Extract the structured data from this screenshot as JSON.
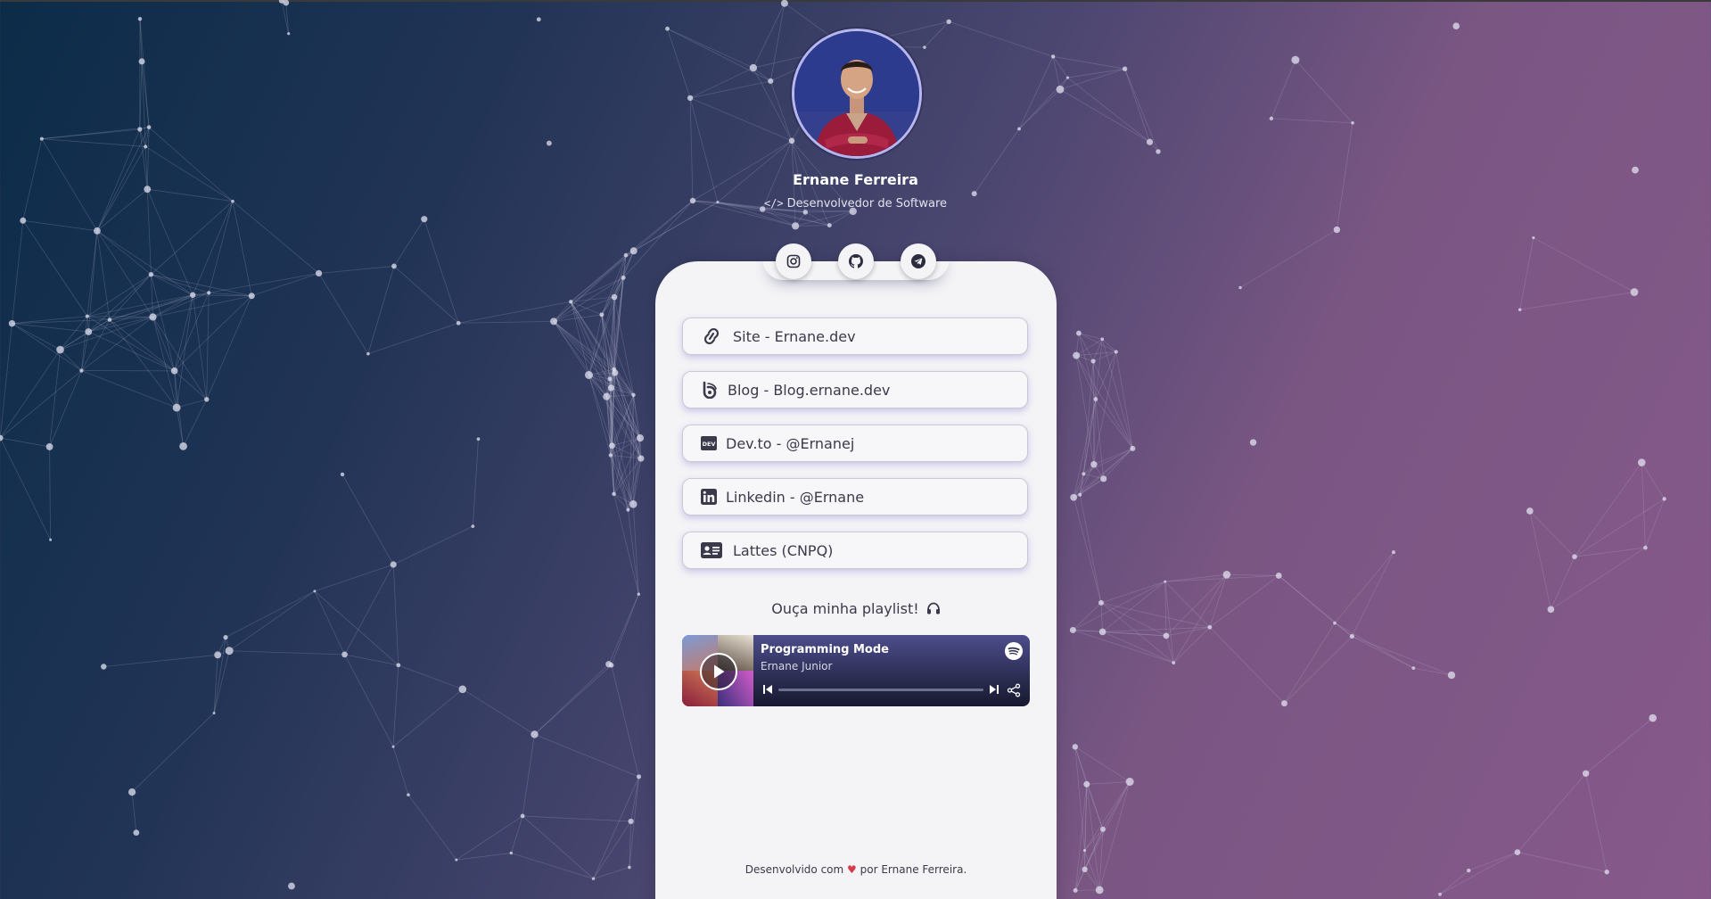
{
  "profile": {
    "name": "Ernane Ferreira",
    "role_icon": "</>",
    "role": "Desenvolvedor de Software",
    "avatar_icon": "avatar-photo"
  },
  "social": [
    {
      "name": "instagram",
      "icon": "instagram-icon"
    },
    {
      "name": "github",
      "icon": "github-icon"
    },
    {
      "name": "telegram",
      "icon": "telegram-icon"
    }
  ],
  "links": [
    {
      "label": "Site - Ernane.dev",
      "icon": "link-icon"
    },
    {
      "label": "Blog - Blog.ernane.dev",
      "icon": "blogger-icon"
    },
    {
      "label": "Dev.to - @Ernanej",
      "icon": "devto-icon"
    },
    {
      "label": "Linkedin - @Ernane",
      "icon": "linkedin-icon"
    },
    {
      "label": "Lattes (CNPQ)",
      "icon": "id-card-icon"
    }
  ],
  "playlist": {
    "heading": "Ouça minha playlist!",
    "title": "Programming Mode",
    "artist": "Ernane Junior",
    "progress": 0
  },
  "footer": {
    "before": "Desenvolvido com",
    "heart": "♥",
    "after": "por Ernane Ferreira."
  },
  "colors": {
    "card": "#f4f4f7",
    "text": "#3a3a4a",
    "heart": "#d93a4a",
    "accent": "#b8b6ee"
  }
}
